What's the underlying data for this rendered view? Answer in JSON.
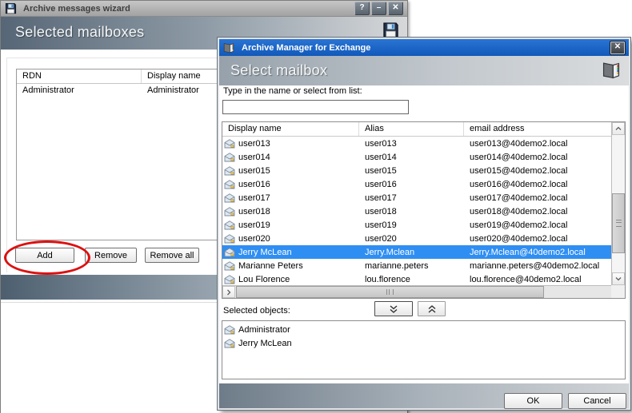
{
  "wizard": {
    "title": "Archive messages wizard",
    "titlebar_buttons": {
      "help": "?",
      "minimize": "–",
      "close": "✕"
    },
    "banner": "Selected mailboxes",
    "table": {
      "columns": {
        "rdn": "RDN",
        "display": "Display name"
      },
      "rows": [
        {
          "rdn": "Administrator",
          "display": "Administrator"
        }
      ]
    },
    "buttons": {
      "add": "Add",
      "remove": "Remove",
      "remove_all": "Remove all"
    }
  },
  "dialog": {
    "title": "Archive Manager for Exchange",
    "close": "✕",
    "banner": "Select mailbox",
    "search": {
      "label": "Type in the name or select from list:",
      "value": "",
      "placeholder": ""
    },
    "list": {
      "columns": {
        "display": "Display name",
        "alias": "Alias",
        "email": "email address"
      },
      "rows": [
        {
          "display": "user013",
          "alias": "user013",
          "email": "user013@40demo2.local"
        },
        {
          "display": "user014",
          "alias": "user014",
          "email": "user014@40demo2.local"
        },
        {
          "display": "user015",
          "alias": "user015",
          "email": "user015@40demo2.local"
        },
        {
          "display": "user016",
          "alias": "user016",
          "email": "user016@40demo2.local"
        },
        {
          "display": "user017",
          "alias": "user017",
          "email": "user017@40demo2.local"
        },
        {
          "display": "user018",
          "alias": "user018",
          "email": "user018@40demo2.local"
        },
        {
          "display": "user019",
          "alias": "user019",
          "email": "user019@40demo2.local"
        },
        {
          "display": "user020",
          "alias": "user020",
          "email": "user020@40demo2.local"
        },
        {
          "display": "Jerry McLean",
          "alias": "Jerry.Mclean",
          "email": "Jerry.Mclean@40demo2.local"
        },
        {
          "display": "Marianne Peters",
          "alias": "marianne.peters",
          "email": "marianne.peters@40demo2.local"
        },
        {
          "display": "Lou Florence",
          "alias": "lou.florence",
          "email": "lou.florence@40demo2.local"
        }
      ],
      "selected_row_display": "Jerry McLean"
    },
    "selected_objects_label": "Selected objects:",
    "selected_objects": [
      {
        "name": "Administrator"
      },
      {
        "name": "Jerry McLean"
      }
    ],
    "buttons": {
      "ok": "OK",
      "cancel": "Cancel"
    }
  },
  "icons": {
    "floppy": "floppy-disk",
    "book": "open-book",
    "mailbox": "mailbox-envelope",
    "chevrons": "up/down/left/right scroll arrows, double up/down move arrows"
  },
  "colors": {
    "titlebar_blue": "#1a66c9",
    "selection_blue": "#2f8ef2",
    "banner_gradient_dark": "#576676",
    "banner_gradient_light": "#d6d8da",
    "highlight_ellipse_red": "#dd1010"
  }
}
